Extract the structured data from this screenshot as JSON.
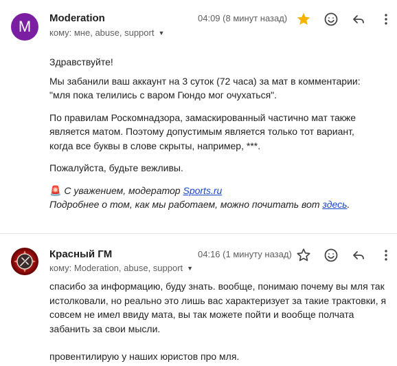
{
  "message1": {
    "avatar_letter": "M",
    "sender": "Moderation",
    "recipients": "кому: мне, abuse, support",
    "time": "04:09 (8 минут назад)",
    "starred": true,
    "greeting": "Здравствуйте!",
    "para1": "Мы забанили ваш аккаунт на 3 суток (72 часа) за мат в комментарии: \"мля пока телились с варом Гюндо мог очухаться\".",
    "para2": "По правилам Роскомнадзора, замаскированный частично мат также является матом. Поэтому допустимым является только тот вариант, когда все буквы в слове скрыты, например, ***.",
    "para3": "Пожалуйста, будьте вежливы.",
    "sig_emoji": "🚨",
    "sig_text": "С уважением, модератор",
    "sig_link": "Sports.ru",
    "more_text": "Подробнее о том, как мы работаем, можно почитать вот",
    "more_link": "здесь",
    "more_end": "."
  },
  "message2": {
    "sender": "Красный ГМ",
    "recipients": "кому: Moderation, abuse, support",
    "time": "04:16 (1 минуту назад)",
    "starred": false,
    "para1": "спасибо за информацию, буду знать. вообще, понимаю почему вы мля так истолковали, но реально это лишь вас характеризует за такие трактовки, я совсем не имел ввиду мата, вы так можете пойти и вообще полчата забанить за свои мысли.",
    "para2": "провентилирую у наших юристов про мля."
  },
  "colors": {
    "star_filled": "#f4b400",
    "avatar_m": "#7b1fa2",
    "link": "#1a47c7"
  },
  "icons": [
    "star-icon",
    "emoji-icon",
    "reply-icon",
    "more-vert-icon",
    "chevron-down-icon"
  ]
}
